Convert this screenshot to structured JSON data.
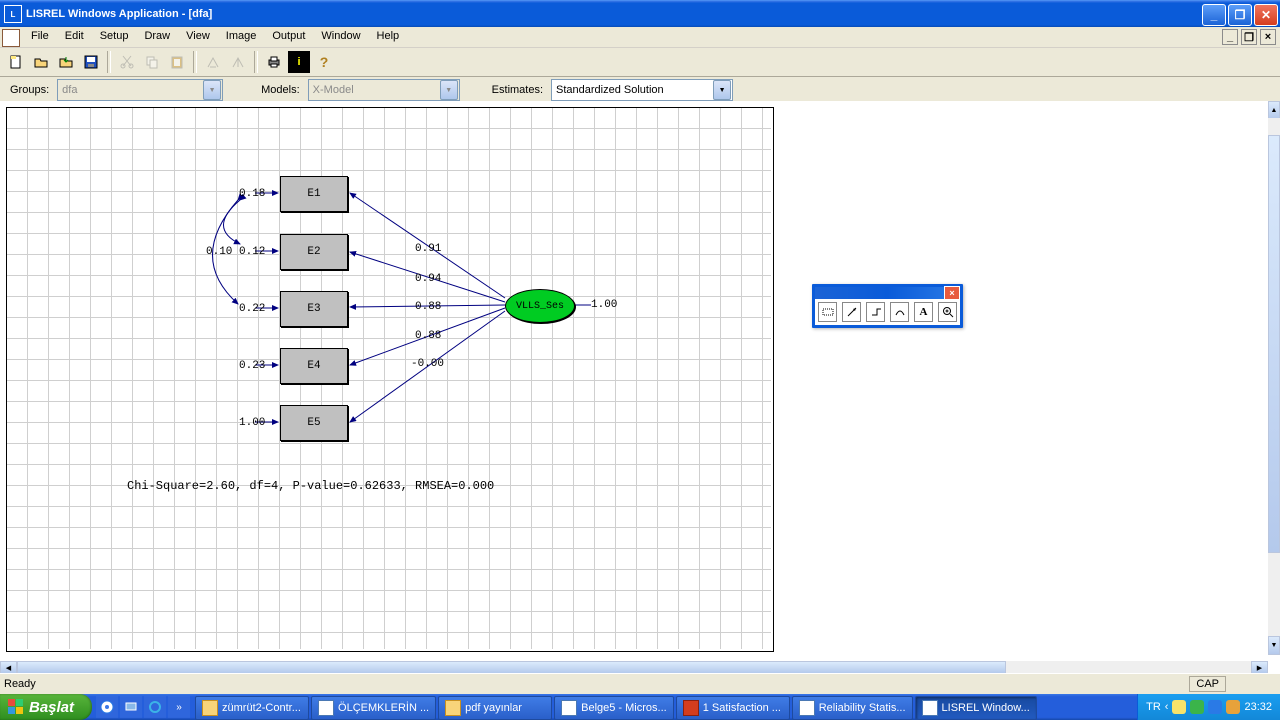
{
  "title": "LISREL Windows Application - [dfa]",
  "menus": [
    "File",
    "Edit",
    "Setup",
    "Draw",
    "View",
    "Image",
    "Output",
    "Window",
    "Help"
  ],
  "optbar": {
    "groups_label": "Groups:",
    "groups_value": "dfa",
    "models_label": "Models:",
    "models_value": "X-Model",
    "estimates_label": "Estimates:",
    "estimates_value": "Standardized Solution"
  },
  "diagram": {
    "observed": [
      {
        "name": "E1",
        "err": "0.18"
      },
      {
        "name": "E2",
        "err": "0.12",
        "err2": "0.10"
      },
      {
        "name": "E3",
        "err": "0.22"
      },
      {
        "name": "E4",
        "err": "0.23"
      },
      {
        "name": "E5",
        "err": "1.00"
      }
    ],
    "latent": "VLLS_Ses",
    "latent_fix": "1.00",
    "loadings": [
      "0.91",
      "0.94",
      "0.88",
      "0.88",
      "-0.00"
    ]
  },
  "fit_line": "Chi-Square=2.60, df=4, P-value=0.62633, RMSEA=0.000",
  "status": {
    "ready": "Ready",
    "cap": "CAP"
  },
  "taskbar": {
    "start": "Başlat",
    "lang": "TR",
    "clock": "23:32",
    "tasks": [
      {
        "label": "zümrüt2-Contr...",
        "icon": "folder"
      },
      {
        "label": "ÖLÇEMKLERİN ...",
        "icon": "doc"
      },
      {
        "label": "pdf yayınlar",
        "icon": "folder"
      },
      {
        "label": "Belge5 - Micros...",
        "icon": "doc"
      },
      {
        "label": "1 Satisfaction ...",
        "icon": "pdf"
      },
      {
        "label": "Reliability Statis...",
        "icon": "doc"
      },
      {
        "label": "LISREL Window...",
        "icon": "doc",
        "active": true
      }
    ]
  }
}
